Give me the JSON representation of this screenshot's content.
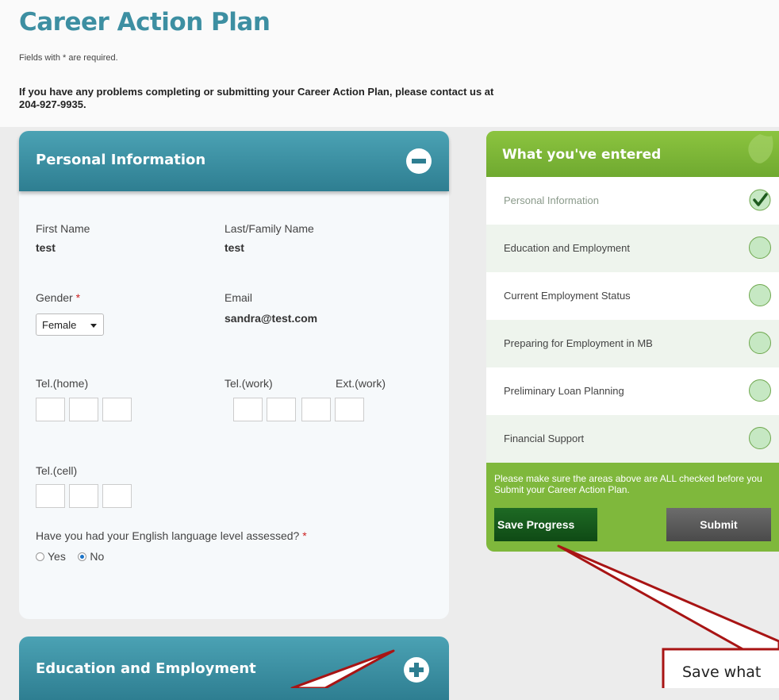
{
  "page": {
    "title": "Career Action Plan",
    "required_note": "Fields with * are required.",
    "contact_note": "If you have any problems completing or submitting your Career Action Plan, please contact us at 204-927-9935."
  },
  "personal": {
    "header": "Personal Information",
    "toggle_icon": "minus-circle-icon",
    "first_name_label": "First Name",
    "first_name_value": "test",
    "last_name_label": "Last/Family Name",
    "last_name_value": "test",
    "gender_label": "Gender",
    "required_mark": "*",
    "gender_value": "Female",
    "email_label": "Email",
    "email_value": "sandra@test.com",
    "tel_home_label": "Tel.(home)",
    "tel_work_label": "Tel.(work)",
    "ext_work_label": "Ext.(work)",
    "tel_cell_label": "Tel.(cell)",
    "english_question": "Have you had your English language level assessed?",
    "yes_label": "Yes",
    "no_label": "No",
    "english_selected": "No"
  },
  "education": {
    "header": "Education and Employment",
    "toggle_icon": "plus-circle-icon"
  },
  "sidebar": {
    "title": "What you've entered",
    "items": [
      {
        "label": "Personal Information",
        "checked": true
      },
      {
        "label": "Education and Employment",
        "checked": false
      },
      {
        "label": "Current Employment Status",
        "checked": false
      },
      {
        "label": "Preparing for Employment in MB",
        "checked": false
      },
      {
        "label": "Preliminary Loan Planning",
        "checked": false
      },
      {
        "label": "Financial Support",
        "checked": false
      }
    ],
    "note": "Please make sure the areas above are ALL checked before you Submit your Career Action Plan.",
    "save_label": "Save Progress",
    "submit_label": "Submit"
  },
  "callout": {
    "text": "Save what"
  },
  "colors": {
    "teal": "#3d8fa2",
    "green": "#7fb83c",
    "save_green": "#1e6a24",
    "callout_red": "#b01212"
  }
}
